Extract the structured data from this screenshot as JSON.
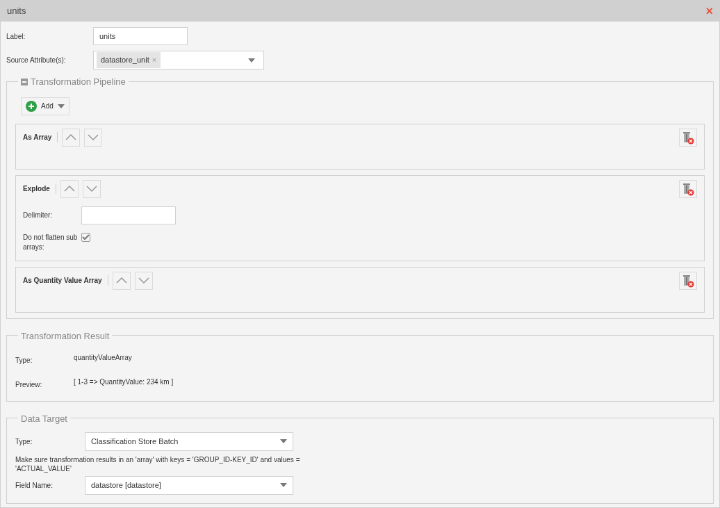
{
  "window": {
    "title": "units",
    "close": "×"
  },
  "label_field": {
    "label": "Label:",
    "value": "units"
  },
  "source_field": {
    "label": "Source Attribute(s):",
    "tags": [
      {
        "text": "datastore_unit",
        "remove": "×"
      }
    ]
  },
  "pipeline": {
    "title": "Transformation Pipeline",
    "collapsed": false,
    "add_button": "Add",
    "steps": [
      {
        "kind": "plain",
        "title": "As Array"
      },
      {
        "kind": "explode",
        "title": "Explode",
        "delimiter": {
          "label": "Delimiter:"
        },
        "flatten": {
          "label": "Do not flatten sub arrays:",
          "checked": true
        }
      },
      {
        "kind": "plain",
        "title": "As Quantity Value Array"
      }
    ]
  },
  "result": {
    "title": "Transformation Result",
    "rows": [
      {
        "label": "Type:",
        "value": "quantityValueArray"
      },
      {
        "label": "Preview:",
        "value": "[ 1-3 => QuantityValue: 234 km ]"
      }
    ]
  },
  "data_target": {
    "title": "Data Target",
    "type": {
      "label": "Type:",
      "value": "Classification Store Batch"
    },
    "hint": "Make sure transformation results in an 'array' with keys = 'GROUP_ID-KEY_ID' and values = 'ACTUAL_VALUE'",
    "field_name": {
      "label": "Field Name:",
      "value": "datastore [datastore]"
    }
  }
}
